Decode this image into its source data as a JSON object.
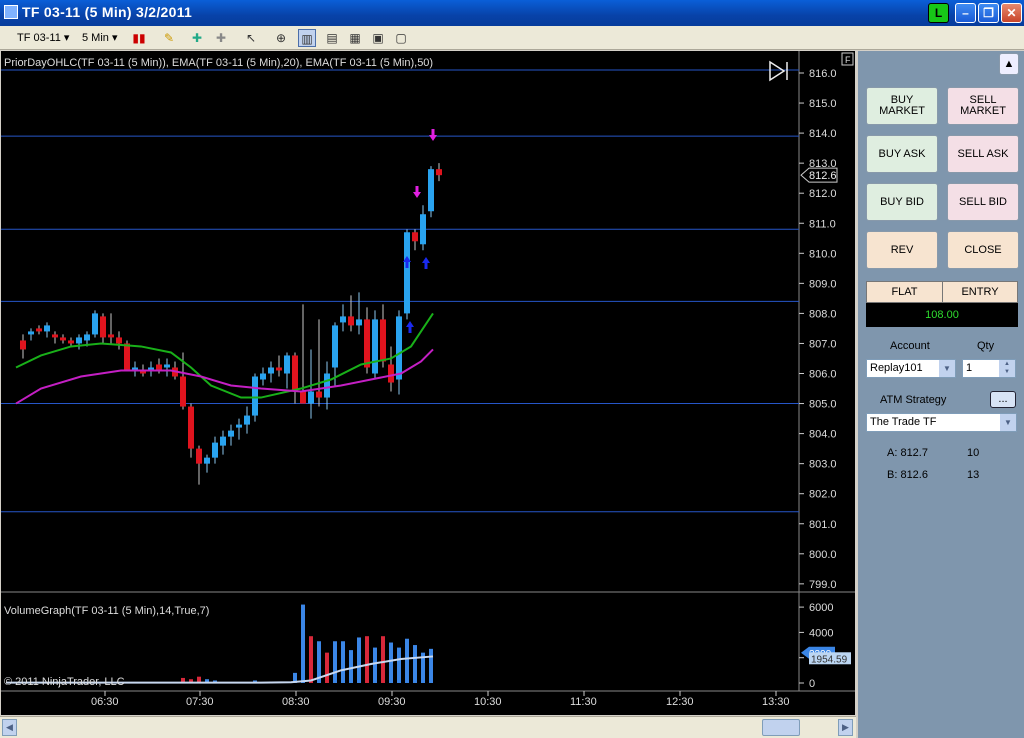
{
  "window": {
    "title": "TF 03-11 (5 Min)  3/2/2011",
    "l_badge": "L"
  },
  "toolbar": {
    "instrument": "TF 03-11",
    "interval": "5 Min"
  },
  "chart": {
    "indicator_label": "PriorDayOHLC(TF 03-11 (5 Min)), EMA(TF 03-11 (5 Min),20), EMA(TF 03-11 (5 Min),50)",
    "volume_label": "VolumeGraph(TF 03-11 (5 Min),14,True,7)",
    "copyright": "© 2011 NinjaTrader, LLC",
    "price_ticks": [
      "816.0",
      "815.0",
      "814.0",
      "813.0",
      "812.0",
      "811.0",
      "810.0",
      "809.0",
      "808.0",
      "807.0",
      "806.0",
      "805.0",
      "804.0",
      "803.0",
      "802.0",
      "801.0",
      "800.0",
      "799.0"
    ],
    "volume_ticks": [
      "6000",
      "4000",
      "2000",
      "0"
    ],
    "time_ticks": [
      "06:30",
      "07:30",
      "08:30",
      "09:30",
      "10:30",
      "11:30",
      "12:30",
      "13:30"
    ],
    "last_price": "812.6",
    "volume_last": "2390",
    "volume_avg": "1954.59",
    "f_marker": "F",
    "colors": {
      "up": "#29a3ef",
      "down": "#e0141e",
      "ema20": "#19b019",
      "ema50": "#c41fc4",
      "grid": "#2656c8"
    }
  },
  "chart_data": {
    "type": "candlestick",
    "series": [
      {
        "name": "price",
        "ylim": [
          798.5,
          816.3
        ]
      },
      {
        "name": "volume",
        "ylim": [
          0,
          6500
        ]
      }
    ],
    "prior_day_levels": [
      816.1,
      813.9,
      810.8,
      808.4,
      805.0,
      801.4
    ]
  },
  "panel": {
    "buy_market": "BUY\nMARKET",
    "sell_market": "SELL\nMARKET",
    "buy_ask": "BUY ASK",
    "sell_ask": "SELL ASK",
    "buy_bid": "BUY BID",
    "sell_bid": "SELL BID",
    "rev": "REV",
    "close": "CLOSE",
    "position": "FLAT",
    "entry": "ENTRY",
    "pnl": "108.00",
    "account_label": "Account",
    "qty_label": "Qty",
    "account": "Replay101",
    "qty": "1",
    "atm_label": "ATM Strategy",
    "atm_btn": "...",
    "atm": "The Trade TF",
    "ask_label": "A: 812.7",
    "ask_size": "10",
    "bid_label": "B: 812.6",
    "bid_size": "13"
  }
}
